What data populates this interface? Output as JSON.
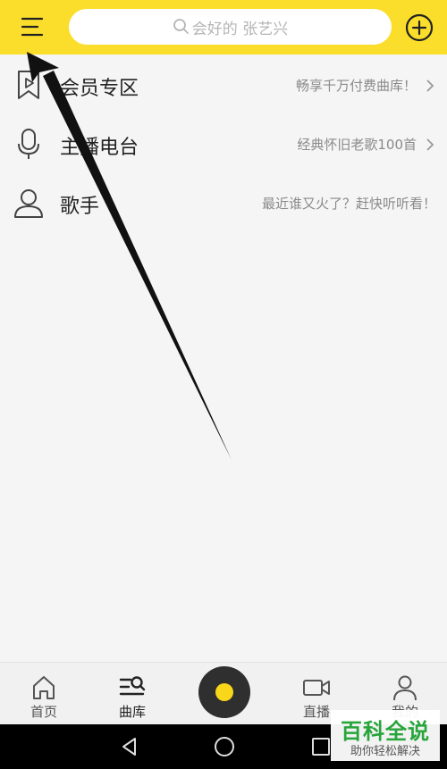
{
  "header": {
    "search_placeholder": "会好的 张艺兴",
    "accent_color": "#fbde2b"
  },
  "rows": [
    {
      "icon": "bookmark-play-icon",
      "title": "会员专区",
      "subtitle": "畅享千万付费曲库！"
    },
    {
      "icon": "microphone-icon",
      "title": "主播电台",
      "subtitle": "经典怀旧老歌100首"
    },
    {
      "icon": "person-icon",
      "title": "歌手",
      "subtitle": "最近谁又火了？赶快听听看！"
    }
  ],
  "tabs": [
    {
      "icon": "home-icon",
      "label": "首页"
    },
    {
      "icon": "library-search-icon",
      "label": "曲库",
      "active": true
    },
    {
      "icon": "video-camera-icon",
      "label": "直播"
    },
    {
      "icon": "user-icon",
      "label": "我的"
    }
  ],
  "watermark": {
    "main": "百科全说",
    "sub": "助你轻松解决"
  }
}
